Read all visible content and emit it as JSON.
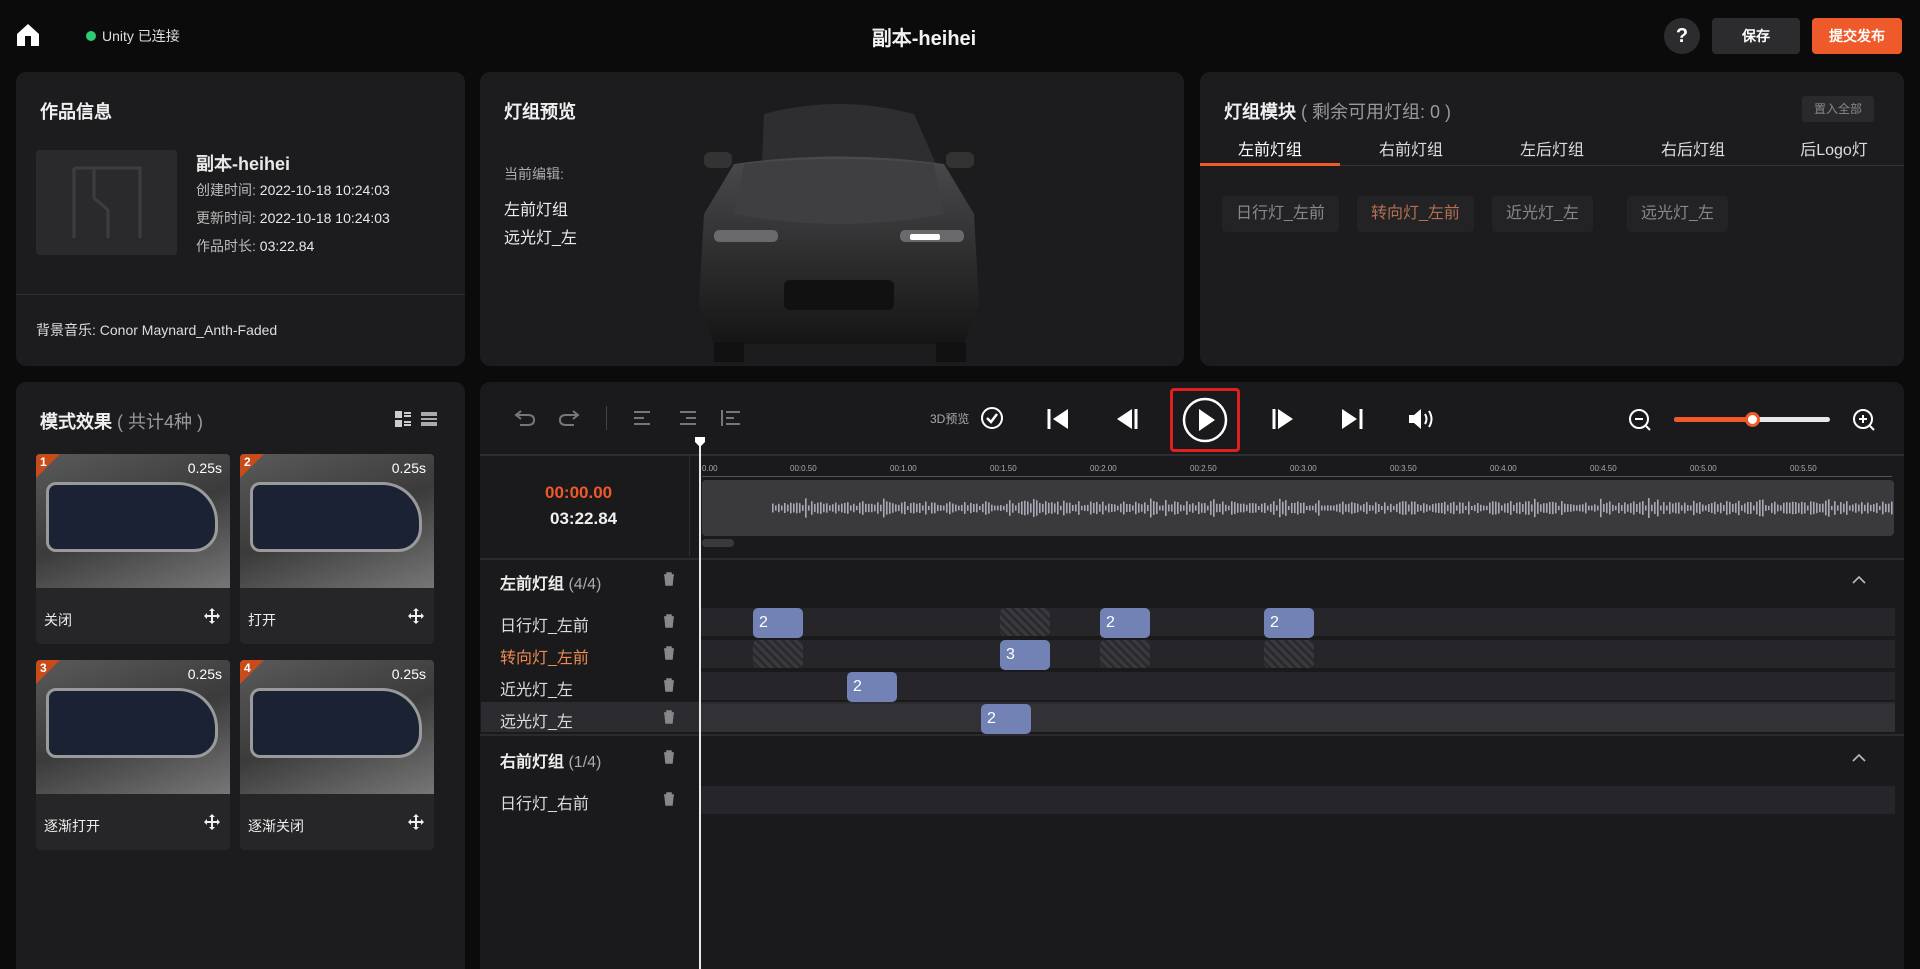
{
  "header": {
    "unity_status": "Unity 已连接",
    "title": "副本-heihei",
    "help": "?",
    "save_label": "保存",
    "publish_label": "提交发布"
  },
  "work_info": {
    "title": "作品信息",
    "name": "副本-heihei",
    "created_label": "创建时间:",
    "created": "2022-10-18 10:24:03",
    "updated_label": "更新时间:",
    "updated": "2022-10-18 10:24:03",
    "duration_label": "作品时长:",
    "duration": "03:22.84",
    "music": "背景音乐: Conor Maynard_Anth-Faded"
  },
  "preview": {
    "title": "灯组预览",
    "editing_label": "当前编辑:",
    "group": "左前灯组",
    "light": "远光灯_左"
  },
  "modules": {
    "title": "灯组模块",
    "remaining": "( 剩余可用灯组: 0 )",
    "all_button": "置入全部",
    "tabs": [
      "左前灯组",
      "右前灯组",
      "左后灯组",
      "右后灯组",
      "后Logo灯"
    ],
    "active_tab": 0,
    "chips": [
      "日行灯_左前",
      "转向灯_左前",
      "近光灯_左",
      "远光灯_左"
    ],
    "highlighted_chip": 1
  },
  "modes": {
    "title": "模式效果",
    "count": "( 共计4种 )",
    "items": [
      {
        "num": "1",
        "duration": "0.25s",
        "label": "关闭"
      },
      {
        "num": "2",
        "duration": "0.25s",
        "label": "打开"
      },
      {
        "num": "3",
        "duration": "0.25s",
        "label": "逐渐打开"
      },
      {
        "num": "4",
        "duration": "0.25s",
        "label": "逐渐关闭"
      }
    ]
  },
  "editor": {
    "preview_3d": "3D预览",
    "current_time": "00:00.00",
    "total_time": "03:22.84",
    "zoom_level": 0.5,
    "ruler_ticks": [
      "0.00",
      "00:0.50",
      "00:1.00",
      "00:1.50",
      "00:2.00",
      "00:2.50",
      "00:3.00",
      "00:3.50",
      "00:4.00",
      "00:4.50",
      "00:5.00",
      "00:5.50"
    ],
    "groups": [
      {
        "name": "左前灯组",
        "count": "(4/4)",
        "tracks": [
          {
            "name": "日行灯_左前",
            "clips": [
              "2",
              "2",
              "2"
            ]
          },
          {
            "name": "转向灯_左前",
            "clips": [
              "3"
            ]
          },
          {
            "name": "近光灯_左",
            "clips": [
              "2"
            ]
          },
          {
            "name": "远光灯_左",
            "clips": [
              "2"
            ]
          }
        ]
      },
      {
        "name": "右前灯组",
        "count": "(1/4)",
        "tracks": [
          {
            "name": "日行灯_右前",
            "clips": []
          }
        ]
      }
    ]
  },
  "colors": {
    "accent": "#ee5a2a",
    "clip": "#7282b4",
    "online": "#2ecc71"
  }
}
